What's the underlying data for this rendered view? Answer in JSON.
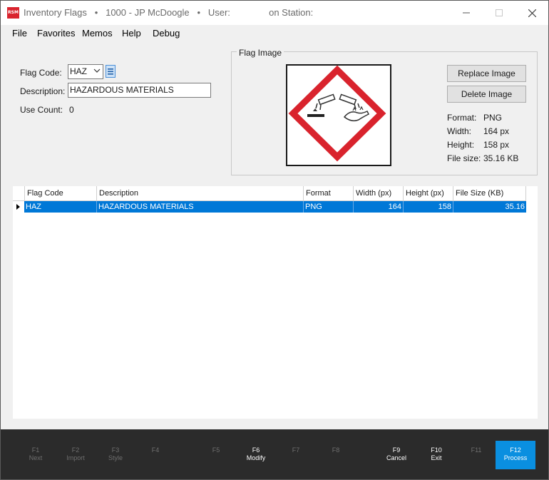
{
  "window": {
    "title": "Inventory Flags   •   1000 - JP McDoogle   •   User:               on Station:",
    "logo_text": "RSM",
    "controls": {
      "minimize": "minimize-icon",
      "maximize": "maximize-icon",
      "close": "close-icon"
    }
  },
  "menu": [
    "File",
    "Favorites",
    "Memos",
    "Help",
    "Debug"
  ],
  "form": {
    "flag_code_label": "Flag Code:",
    "flag_code_value": "HAZ",
    "description_label": "Description:",
    "description_value": "HAZARDOUS MATERIALS",
    "use_count_label": "Use Count:",
    "use_count_value": "0"
  },
  "flag_image": {
    "group_title": "Flag Image",
    "replace_label": "Replace Image",
    "delete_label": "Delete Image",
    "format_label": "Format:",
    "format_value": "PNG",
    "width_label": "Width:",
    "width_value": "164 px",
    "height_label": "Height:",
    "height_value": "158 px",
    "filesize_label": "File size:",
    "filesize_value": "35.16 KB",
    "image_icon": "corrosive-hazard-icon"
  },
  "grid": {
    "columns": [
      "Flag Code",
      "Description",
      "Format",
      "Width (px)",
      "Height (px)",
      "File Size (KB)"
    ],
    "rows": [
      [
        "HAZ",
        "HAZARDOUS MATERIALS",
        "PNG",
        "164",
        "158",
        "35.16"
      ]
    ]
  },
  "function_keys": [
    {
      "key": "F1",
      "label": "Next"
    },
    {
      "key": "F2",
      "label": "Import"
    },
    {
      "key": "F3",
      "label": "Style"
    },
    {
      "key": "F4",
      "label": ""
    },
    {
      "key": "F5",
      "label": ""
    },
    {
      "key": "F6",
      "label": "Modify"
    },
    {
      "key": "F7",
      "label": ""
    },
    {
      "key": "F8",
      "label": ""
    },
    {
      "key": "F9",
      "label": "Cancel"
    },
    {
      "key": "F10",
      "label": "Exit"
    },
    {
      "key": "F11",
      "label": ""
    },
    {
      "key": "F12",
      "label": "Process"
    }
  ],
  "colors": {
    "selection": "#0078d7",
    "primary_key": "#0a8fe0",
    "hazard_red": "#d9232d",
    "logo_red": "#d9232d"
  }
}
